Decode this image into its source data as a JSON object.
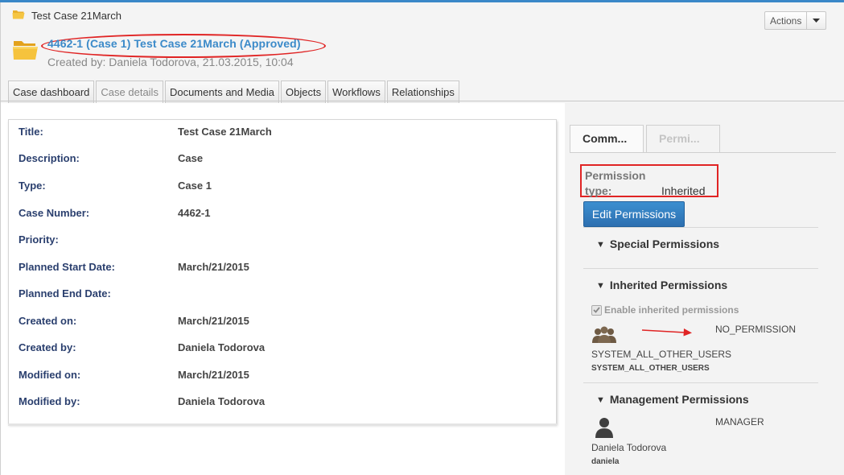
{
  "breadcrumb": {
    "label": "Test Case 21March"
  },
  "header": {
    "actions_label": "Actions",
    "case_title": "4462-1 (Case 1) Test Case 21March (Approved)",
    "created_line": "Created by: Daniela Todorova, 21.03.2015, 10:04"
  },
  "tabs": [
    {
      "label": "Case dashboard"
    },
    {
      "label": "Case details"
    },
    {
      "label": "Documents and Media"
    },
    {
      "label": "Objects"
    },
    {
      "label": "Workflows"
    },
    {
      "label": "Relationships"
    }
  ],
  "details": [
    {
      "label": "Title:",
      "value": "Test Case 21March"
    },
    {
      "label": "Description:",
      "value": "Case"
    },
    {
      "label": "Type:",
      "value": "Case 1"
    },
    {
      "label": "Case Number:",
      "value": "4462-1"
    },
    {
      "label": "Priority:",
      "value": ""
    },
    {
      "label": "Planned Start Date:",
      "value": "March/21/2015"
    },
    {
      "label": "Planned End Date:",
      "value": ""
    },
    {
      "label": "Created on:",
      "value": "March/21/2015"
    },
    {
      "label": "Created by:",
      "value": "Daniela Todorova"
    },
    {
      "label": "Modified on:",
      "value": "March/21/2015"
    },
    {
      "label": "Modified by:",
      "value": "Daniela Todorova"
    }
  ],
  "side": {
    "tabs": [
      {
        "label": "Comm..."
      },
      {
        "label": "Permi..."
      }
    ],
    "permission_type_label": "Permission type:",
    "permission_type_value": "Inherited",
    "edit_button": "Edit Permissions",
    "special_title": "Special Permissions",
    "inherited_title": "Inherited Permissions",
    "enable_inherited_label": "Enable inherited permissions",
    "inherited_entry": {
      "role": "NO_PERMISSION",
      "name": "SYSTEM_ALL_OTHER_USERS",
      "sub": "SYSTEM_ALL_OTHER_USERS"
    },
    "management_title": "Management Permissions",
    "management_entry": {
      "role": "MANAGER",
      "name": "Daniela Todorova",
      "sub": "daniela"
    }
  },
  "colors": {
    "link": "#3b8ac9",
    "label_navy": "#2a3f6e",
    "primary_button": "#2d6fb0",
    "annotation_red": "#e02424"
  }
}
